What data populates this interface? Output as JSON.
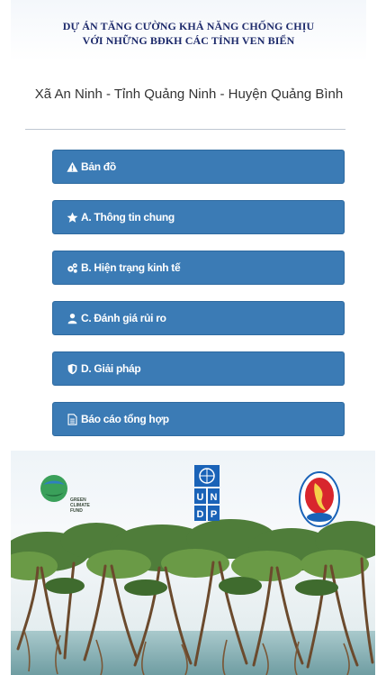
{
  "header": {
    "title_line1": "DỰ ÁN TĂNG CƯỜNG KHẢ NĂNG CHỐNG CHỊU",
    "title_line2": "VỚI NHỮNG BĐKH CÁC TỈNH VEN BIỂN"
  },
  "location": "Xã An Ninh - Tỉnh Quảng Ninh - Huyện Quảng Bình",
  "menu": {
    "items": [
      {
        "label": "Bản đồ",
        "icon": "warning-icon"
      },
      {
        "label": "A. Thông tin chung",
        "icon": "star-icon"
      },
      {
        "label": "B. Hiện trạng kinh tế",
        "icon": "gears-icon"
      },
      {
        "label": "C. Đánh giá rủi ro",
        "icon": "user-icon"
      },
      {
        "label": "D. Giải pháp",
        "icon": "shield-icon"
      },
      {
        "label": "Báo cáo tổng hợp",
        "icon": "document-icon"
      }
    ]
  },
  "banner": {
    "gcf_text": [
      "GREEN",
      "CLIMATE",
      "FUND"
    ],
    "undp_letters": [
      "U",
      "N",
      "D",
      "P"
    ]
  },
  "colors": {
    "button": "#3b7bb5",
    "header_text": "#1d2a6b"
  }
}
